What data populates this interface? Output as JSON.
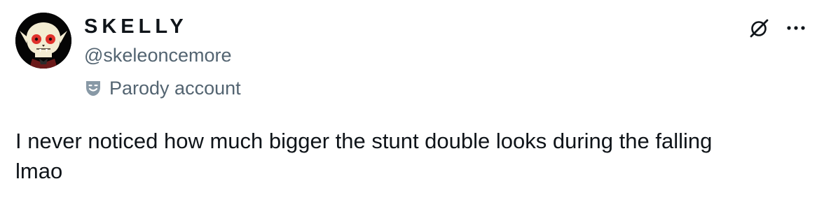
{
  "author": {
    "display_name": "SKELLY",
    "handle": "@skeleoncemore",
    "label": "Parody account"
  },
  "icons": {
    "avatar": "skeleton-avatar",
    "label_icon": "parody-mask-icon",
    "action_1": "grok-icon",
    "action_2": "more-icon"
  },
  "colors": {
    "text": "#0f1419",
    "secondary": "#536471",
    "avatar_bg": "#050505",
    "avatar_eyes": "#e0312b"
  },
  "tweet": {
    "text": "I never noticed how much bigger the stunt double looks during the falling\nlmao"
  }
}
